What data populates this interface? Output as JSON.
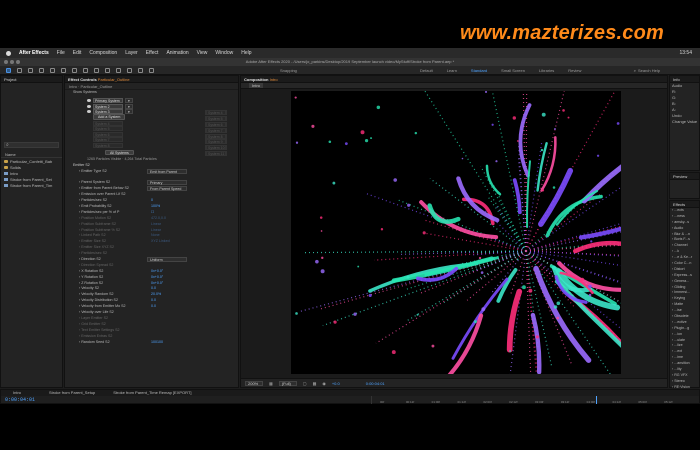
{
  "watermark": "www.mazterizes.com",
  "menubar": {
    "app_name": "After Effects",
    "items": [
      "File",
      "Edit",
      "Composition",
      "Layer",
      "Effect",
      "Animation",
      "View",
      "Window",
      "Help"
    ],
    "time": "13:54"
  },
  "window_title": "Adobe After Effects 2020 - /Users/jo_parkins/Desktop/2019 September launch video/MyStuff/Stroke from Parent.aep *",
  "toolbar": {
    "snapping_label": "Snapping",
    "workspaces": [
      "Default",
      "Learn",
      "Standard",
      "Small Screen",
      "Libraries",
      "Review"
    ],
    "active_workspace": "Standard",
    "search_help": "Search Help"
  },
  "project": {
    "tab_label": "Project",
    "column_name": "Name",
    "items": [
      {
        "name": "Particular_Confetti_Bab",
        "kind": "folder"
      },
      {
        "name": "Solids",
        "kind": "folder"
      },
      {
        "name": "Intro",
        "kind": "comp"
      },
      {
        "name": "Stroke from Parent_Set",
        "kind": "comp"
      },
      {
        "name": "Stroke from Parent_Tim",
        "kind": "comp"
      }
    ]
  },
  "effects": {
    "tab_label": "Effect Controls",
    "tab_layer": "Particular_Outline",
    "header": "Intro · Particular_Outline",
    "show_systems": "Show Systems",
    "systems": [
      "Primary System",
      "System 2",
      "System 3"
    ],
    "ghost_systems": [
      "System 4",
      "System 5",
      "System 6",
      "System 7",
      "System 8"
    ],
    "ghost_systems_right": [
      "System 4",
      "System 5",
      "System 6",
      "System 7",
      "System 8",
      "System 9",
      "System 10",
      "System 11"
    ],
    "add_system": "Add a System",
    "all_systems": "All Systems",
    "particle_counts": "1265 Particles Visible · 4,264 Total Particles",
    "section_title": "Emitter S2",
    "rows": [
      {
        "label": "Emitter Type S2",
        "value": "Emit from Parent",
        "type": "dropdown"
      },
      {
        "label": "",
        "value": "",
        "type": "gap"
      },
      {
        "label": "Parent System S2",
        "value": "Primary",
        "type": "dropdown"
      },
      {
        "label": "Emitter from Parent Behav S2",
        "value": "From Parent Speed",
        "type": "dropdown"
      },
      {
        "label": "Emission over Parent Lif S2",
        "value": "",
        "type": "plain"
      },
      {
        "label": "Particles/sec S2",
        "value": "0",
        "type": "plain"
      },
      {
        "label": "Emit Probability S2",
        "value": "100%",
        "type": "plain"
      },
      {
        "label": "Particles/sec per % of P",
        "value": "",
        "type": "check"
      },
      {
        "label": "Position Motion S2",
        "value": "472.0,0.0",
        "type": "dim"
      },
      {
        "label": "Position Subframe S2",
        "value": "Linear",
        "type": "dim"
      },
      {
        "label": "Position Subframe % S2",
        "value": "Linear",
        "type": "dim"
      },
      {
        "label": "Linked Path S2",
        "value": "None",
        "type": "dim"
      },
      {
        "label": "Emitter Size S2",
        "value": "XYZ Linked",
        "type": "dim"
      },
      {
        "label": "Emitter Size XYZ S2",
        "value": "",
        "type": "dim"
      },
      {
        "label": "Particles/sec S2",
        "value": "",
        "type": "dim"
      },
      {
        "label": "Direction S2",
        "value": "Uniform",
        "type": "dropdown"
      },
      {
        "label": "Direction Spread S2",
        "value": "",
        "type": "dim"
      },
      {
        "label": "X Rotation S2",
        "value": "0x+0.0°",
        "type": "plain"
      },
      {
        "label": "Y Rotation S2",
        "value": "0x+0.0°",
        "type": "plain"
      },
      {
        "label": "Z Rotation S2",
        "value": "0x+0.0°",
        "type": "plain"
      },
      {
        "label": "Velocity S2",
        "value": "0.0",
        "type": "plain"
      },
      {
        "label": "Velocity Random S2",
        "value": "20.0%",
        "type": "plain"
      },
      {
        "label": "Velocity Distribution S2",
        "value": "0.0",
        "type": "plain"
      },
      {
        "label": "Velocity from Emitter Mo S2",
        "value": "0.0",
        "type": "plain"
      },
      {
        "label": "Velocity over Life S2",
        "value": "",
        "type": "plain"
      },
      {
        "label": "Layer Emitter S2",
        "value": "",
        "type": "dim"
      },
      {
        "label": "Grid Emitter S2",
        "value": "",
        "type": "dim"
      },
      {
        "label": "Text Emitter Settings S2",
        "value": "",
        "type": "dim"
      },
      {
        "label": "Emission Extras S2",
        "value": "",
        "type": "dim"
      },
      {
        "label": "Random Seed S2",
        "value": "100100",
        "type": "plain"
      }
    ]
  },
  "composition": {
    "tab_label": "Composition",
    "tab_comp": "Intro",
    "sub_tab": "Intro",
    "zoom": "200%",
    "resolution": "(Full)",
    "timecode": "0:00:04:01",
    "plus": "+0.0"
  },
  "right_panels": {
    "info": "Info",
    "audio": "Audio",
    "undo_label": "Undo",
    "undo_detail": "Change Value",
    "info_values": [
      "R:",
      "G:",
      "B:",
      "A:"
    ],
    "preview": "Preview",
    "effects_presets": "Effects",
    "fx_items": [
      "...ects",
      "...ness",
      "amsky...s",
      "Audio",
      "Blur & ...n",
      "Boris F...s",
      "Channel",
      "...k",
      "...e & Ke...r",
      "Color C...n",
      "Distort",
      "Express...s",
      "Genera...",
      "Gliding",
      "Immersi...",
      "Keying",
      "Matte",
      "...ise",
      "Obsolete",
      "...ective",
      "Plugin...g",
      "...ion",
      "...ulate",
      "...lize",
      "...ext",
      "...ime",
      "...ansition",
      "...lity",
      "RG VFX",
      "Stereo",
      "RE:Vision"
    ]
  },
  "timeline": {
    "tabs": [
      "Intro",
      "Stroke from Parent_Setup",
      "Stroke from Parent_Time Remap [EXPORT]"
    ],
    "timecode": "0:00:04:01",
    "ticks": [
      "00f",
      "00:12f",
      "01:00f",
      "01:12f",
      "02:00f",
      "02:12f",
      "03:00f",
      "03:12f",
      "04:00f",
      "04:12f",
      "05:00f",
      "05:12f"
    ]
  }
}
